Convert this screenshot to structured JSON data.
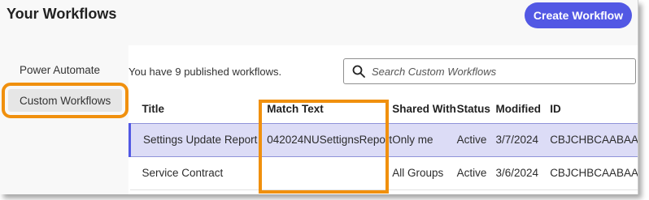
{
  "header": {
    "title": "Your Workflows",
    "create_label": "Create Workflow"
  },
  "sidebar": {
    "items": [
      {
        "label": "Power Automate"
      },
      {
        "label": "Custom Workflows"
      }
    ]
  },
  "main": {
    "count_text": "You have 9 published workflows.",
    "search": {
      "placeholder": "Search Custom Workflows",
      "value": ""
    },
    "columns": [
      "Title",
      "Match Text",
      "Shared With",
      "Status",
      "Modified",
      "ID"
    ],
    "rows": [
      {
        "title": "Settings Update Report",
        "match": "042024NUSettignsReport",
        "shared": "Only me",
        "status": "Active",
        "modified": "3/7/2024",
        "id": "CBJCHBCAABAA"
      },
      {
        "title": "Service Contract",
        "match": "",
        "shared": "All Groups",
        "status": "Active",
        "modified": "3/6/2024",
        "id": "CBJCHBCAABAA"
      }
    ]
  },
  "colors": {
    "accent": "#5258e4",
    "highlight": "#f0900e",
    "selected_row": "#dcdcf6"
  },
  "icons": {
    "search": "search-icon"
  }
}
